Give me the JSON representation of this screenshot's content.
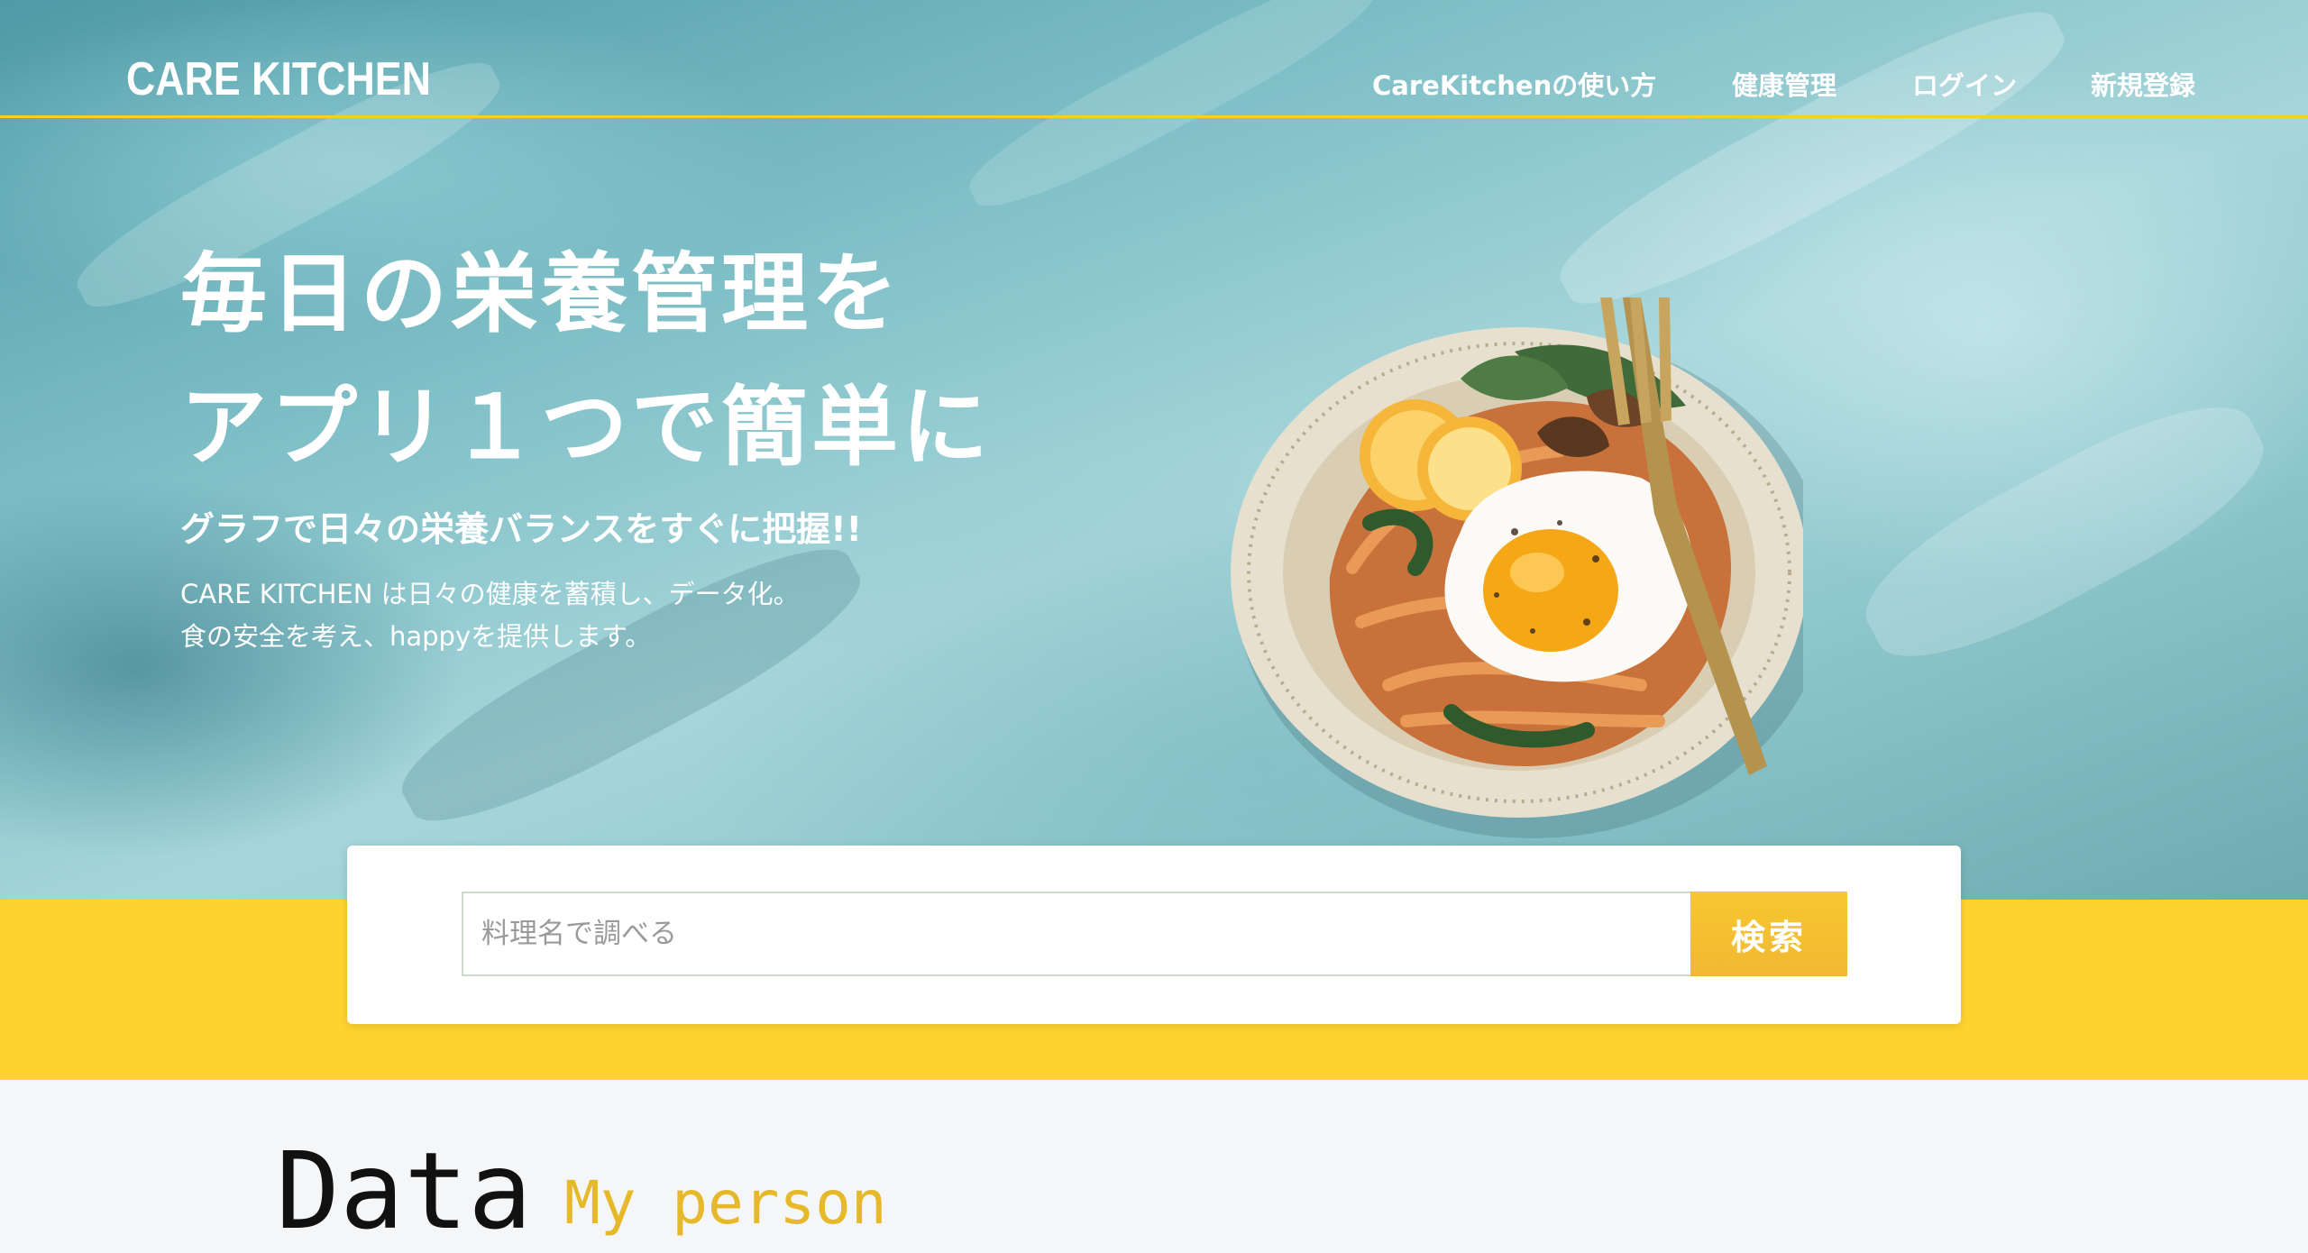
{
  "header": {
    "logo": "CARE KITCHEN",
    "nav": [
      {
        "label": "CareKitchenの使い方"
      },
      {
        "label": "健康管理"
      },
      {
        "label": "ログイン"
      },
      {
        "label": "新規登録"
      }
    ]
  },
  "hero": {
    "headline_line1": "毎日の栄養管理を",
    "headline_line2": "アプリ１つで簡単に",
    "subheading": "グラフで日々の栄養バランスをすぐに把握!!",
    "description_line1": "CARE KITCHEN は日々の健康を蓄積し、データ化。",
    "description_line2": "食の安全を考え、happyを提供します。",
    "image_subject": "plate-with-fried-egg-and-fork"
  },
  "search": {
    "placeholder": "料理名で調べる",
    "value": "",
    "button_label": "検索"
  },
  "data_section": {
    "title": "Data",
    "subtitle": "My person"
  },
  "colors": {
    "accent_yellow": "#fed330",
    "button_yellow": "#f3be30",
    "subtitle_gold": "#e5b92a",
    "hero_teal": "#7dbec6",
    "section_bg": "#f5f6f8"
  }
}
